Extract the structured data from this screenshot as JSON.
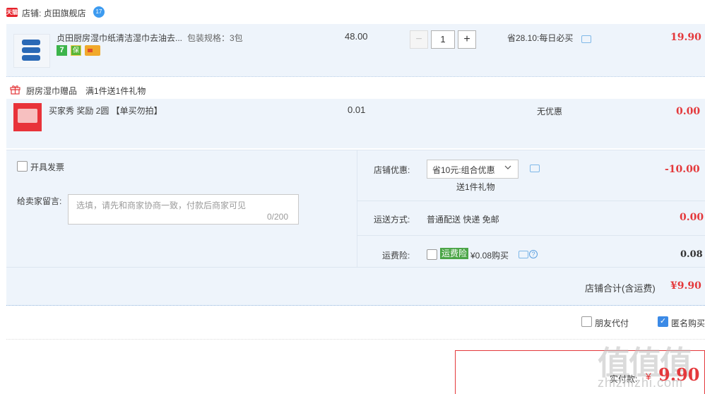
{
  "store": {
    "badge": "天猫",
    "label": "店铺: 贞田旗舰店",
    "ww_badge": "17"
  },
  "item": {
    "title": "贞田厨房湿巾纸清洁湿巾去油去...",
    "sku": "包装规格：3包",
    "price": "48.00",
    "quantity": "1",
    "minus": "−",
    "plus": "+",
    "promo": "省28.10:每日必买",
    "subtotal": "19.90",
    "badge_7": "7",
    "badge_shield": "保"
  },
  "gift": {
    "header": "厨房湿巾赠品　满1件送1件礼物",
    "title": "买家秀 奖励 2圆 【单买勿拍】",
    "price": "0.01",
    "discount": "无优惠",
    "subtotal": "0.00"
  },
  "options": {
    "invoice_label": "开具发票",
    "message_label": "给卖家留言:",
    "message_placeholder": "选填，请先和商家协商一致，付款后商家可见",
    "message_count": "0/200",
    "store_discount_label": "店铺优惠:",
    "store_discount_value": "省10元:组合优惠",
    "gift_note": "送1件礼物",
    "store_discount_amount": "-10.00",
    "shipping_label": "运送方式:",
    "shipping_value": "普通配送 快递 免邮",
    "shipping_amount": "0.00",
    "insurance_label": "运费险:",
    "insurance_tag": "运费险",
    "insurance_price": "¥0.08购买",
    "insurance_amount": "0.08",
    "store_total_label": "店铺合计(含运费)",
    "store_total": "¥9.90"
  },
  "footer": {
    "friend_pay": "朋友代付",
    "anonymous": "匿名购买",
    "pay_label": "实付款:",
    "pay_yen": "¥",
    "pay_amount": "9.90"
  },
  "watermark": {
    "main": "值值值",
    "sub": "zhizhizhi.com"
  },
  "colors": {
    "accent_red": "#e4393c",
    "row_bg": "#eef4fb",
    "checkbox_blue": "#3b8ae6",
    "insurance_green": "#4ba547"
  }
}
